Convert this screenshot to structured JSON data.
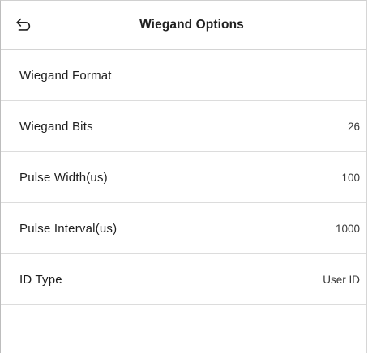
{
  "header": {
    "title": "Wiegand Options",
    "back_icon": "back-arrow-icon"
  },
  "options": [
    {
      "label": "Wiegand Format",
      "value": ""
    },
    {
      "label": "Wiegand Bits",
      "value": "26"
    },
    {
      "label": "Pulse Width(us)",
      "value": "100"
    },
    {
      "label": "Pulse Interval(us)",
      "value": "1000"
    },
    {
      "label": "ID Type",
      "value": "User ID"
    }
  ]
}
